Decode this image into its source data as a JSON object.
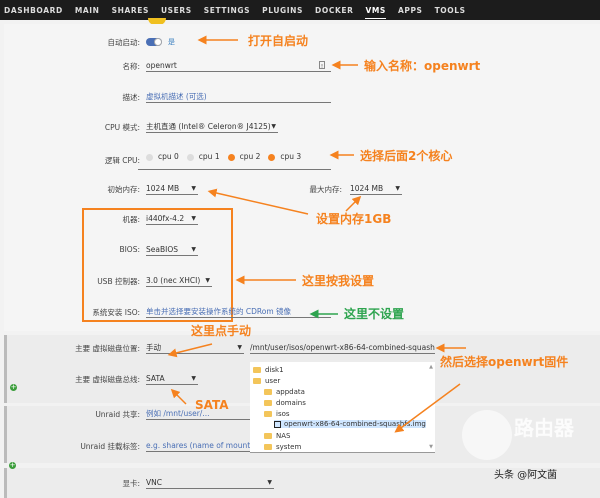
{
  "nav": [
    "DASHBOARD",
    "MAIN",
    "SHARES",
    "USERS",
    "SETTINGS",
    "PLUGINS",
    "DOCKER",
    "VMS",
    "APPS",
    "TOOLS"
  ],
  "nav_active": "VMS",
  "form": {
    "autostart_label": "自动启动:",
    "autostart_value": "是",
    "name_label": "名称:",
    "name_value": "openwrt",
    "desc_label": "描述:",
    "desc_placeholder": "虚拟机描述 (可选)",
    "cpu_mode_label": "CPU 模式:",
    "cpu_mode_value": "主机直通 (Intel® Celeron® J4125)",
    "logical_cpu_label": "逻辑 CPU:",
    "cpus": [
      {
        "label": "cpu 0",
        "checked": false
      },
      {
        "label": "cpu 1",
        "checked": false
      },
      {
        "label": "cpu 2",
        "checked": true
      },
      {
        "label": "cpu 3",
        "checked": true
      }
    ],
    "init_mem_label": "初始内存:",
    "init_mem_value": "1024 MB",
    "max_mem_label": "最大内存:",
    "max_mem_value": "1024 MB",
    "machine_label": "机器:",
    "machine_value": "i440fx-4.2",
    "bios_label": "BIOS:",
    "bios_value": "SeaBIOS",
    "usb_label": "USB 控制器:",
    "usb_value": "3.0 (nec XHCI)",
    "iso_label": "系统安装 ISO:",
    "iso_placeholder": "单击并选择要安装操作系统的 CDRom 镜像",
    "disk_loc_label": "主要 虚拟磁盘位置:",
    "disk_loc_value": "手动",
    "disk_path": "/mnt/user/isos/openwrt-x86-64-combined-squash",
    "disk_bus_label": "主要 虚拟磁盘总线:",
    "disk_bus_value": "SATA",
    "share_label": "Unraid 共享:",
    "share_placeholder": "例如 /mnt/user/...",
    "mount_label": "Unraid 挂载标签:",
    "mount_placeholder": "e.g. shares (name of mount t",
    "gpu_label": "显卡:",
    "gpu_value": "VNC"
  },
  "tree": [
    "disk1",
    "user",
    "appdata",
    "domains",
    "isos",
    "openwrt-x86-64-combined-squashfs.img",
    "NAS",
    "system"
  ],
  "annotations": {
    "a1": "打开自启动",
    "a2": "输入名称：openwrt",
    "a3": "选择后面2个核心",
    "a4": "设置内存1GB",
    "a5": "这里按我设置",
    "a6": "这里不设置",
    "a7": "这里点手动",
    "a8": "然后选择openwrt固件",
    "a9": "SATA"
  },
  "watermark": {
    "logo": "路由器",
    "credit": "头条 @阿文菌"
  },
  "colors": {
    "accent": "#f5821f",
    "green": "#2ea44f",
    "nav": "#1c1c1c"
  }
}
